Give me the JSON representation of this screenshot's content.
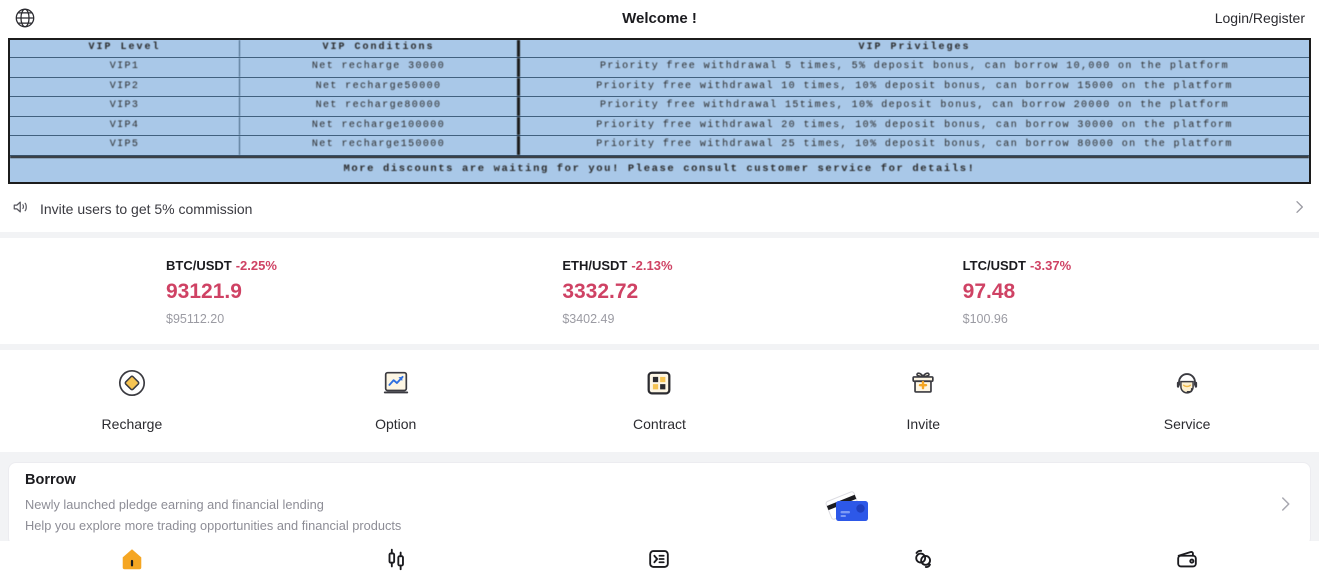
{
  "header": {
    "globe_icon": "globe-icon",
    "title": "Welcome !",
    "login_label": "Login/Register"
  },
  "banner": {
    "type": "vip-table-image",
    "columns": [
      "VIP Level",
      "VIP Conditions",
      "VIP Privileges"
    ],
    "rows": [
      {
        "level": "VIP1",
        "condition": "Net recharge 30000",
        "privilege": "Priority free withdrawal 5 times, 5% deposit bonus, can borrow 10,000 on the platform"
      },
      {
        "level": "VIP2",
        "condition": "Net recharge50000",
        "privilege": "Priority free withdrawal 10 times, 10% deposit bonus, can borrow 15000 on the platform"
      },
      {
        "level": "VIP3",
        "condition": "Net recharge80000",
        "privilege": "Priority free withdrawal 15times, 10% deposit bonus, can borrow 20000 on the platform"
      },
      {
        "level": "VIP4",
        "condition": "Net recharge100000",
        "privilege": "Priority free withdrawal 20 times, 10% deposit bonus, can borrow 30000 on the platform"
      },
      {
        "level": "VIP5",
        "condition": "Net recharge150000",
        "privilege": "Priority free withdrawal 25 times, 10% deposit bonus, can borrow 80000 on the platform"
      }
    ],
    "footer": "More discounts are waiting for you! Please consult customer service for details!"
  },
  "notice": {
    "icon": "speaker-icon",
    "text": "Invite users to get 5% commission",
    "chevron": "chevron-right-icon"
  },
  "tickers": [
    {
      "pair": "BTC/USDT",
      "change": "-2.25%",
      "price": "93121.9",
      "usd": "$95112.20"
    },
    {
      "pair": "ETH/USDT",
      "change": "-2.13%",
      "price": "3332.72",
      "usd": "$3402.49"
    },
    {
      "pair": "LTC/USDT",
      "change": "-3.37%",
      "price": "97.48",
      "usd": "$100.96"
    }
  ],
  "quick_actions": [
    {
      "icon": "diamond-coin-icon",
      "label": "Recharge"
    },
    {
      "icon": "chart-option-icon",
      "label": "Option"
    },
    {
      "icon": "grid-contract-icon",
      "label": "Contract"
    },
    {
      "icon": "gift-invite-icon",
      "label": "Invite"
    },
    {
      "icon": "headset-icon",
      "label": "Service"
    }
  ],
  "borrow": {
    "title": "Borrow",
    "line1": "Newly launched pledge earning and financial lending",
    "line2": "Help you explore more trading opportunities and financial products",
    "art": "credit-card-icon",
    "chevron": "chevron-right-icon"
  },
  "tabbar": [
    {
      "icon": "home-icon",
      "active": true
    },
    {
      "icon": "markets-icon",
      "active": false
    },
    {
      "icon": "orders-icon",
      "active": false
    },
    {
      "icon": "contract-icon",
      "active": false
    },
    {
      "icon": "wallet-icon",
      "active": false
    }
  ],
  "colors": {
    "accent": "#f5a623",
    "down": "#cf4264",
    "page_bg": "#f2f3f5",
    "card_bg": "#ffffff",
    "muted": "#9b9ba3",
    "banner_blue": "#a9c8e8",
    "card_art_blue": "#2d58e8"
  }
}
